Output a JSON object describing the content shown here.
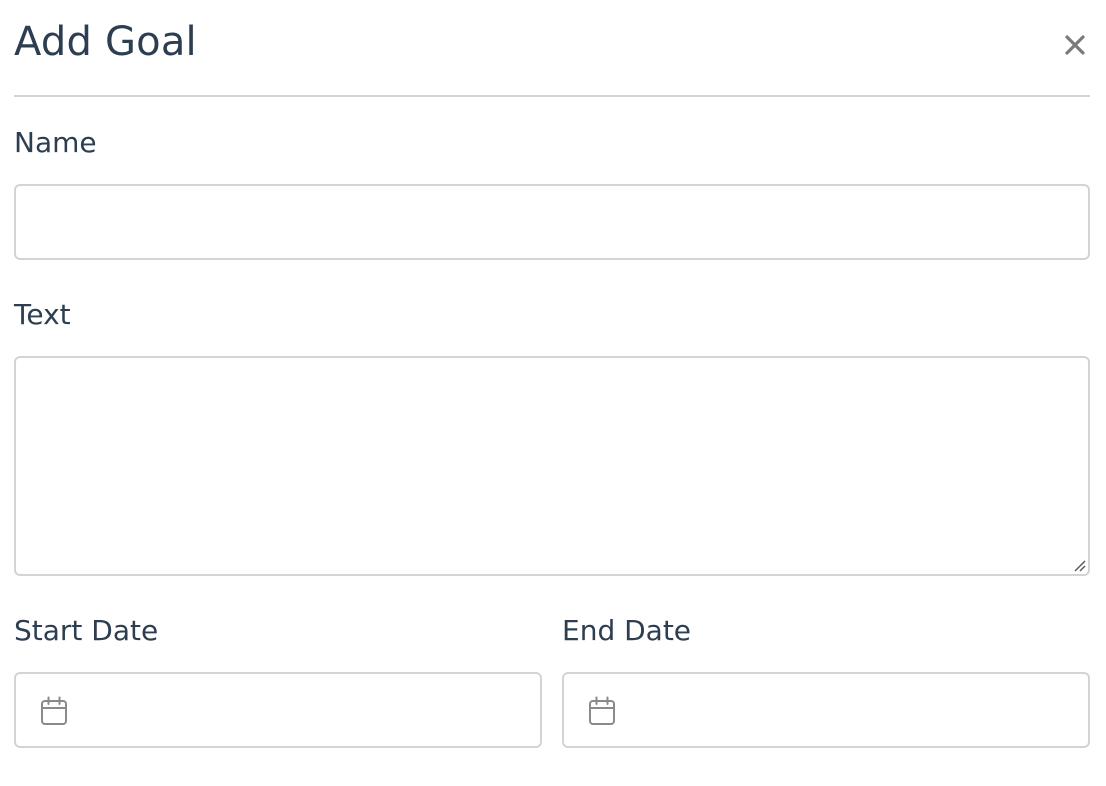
{
  "dialog": {
    "title": "Add Goal",
    "close_label": "×"
  },
  "form": {
    "name": {
      "label": "Name",
      "value": "",
      "placeholder": ""
    },
    "text": {
      "label": "Text",
      "value": "",
      "placeholder": ""
    },
    "start_date": {
      "label": "Start Date",
      "value": "",
      "placeholder": ""
    },
    "end_date": {
      "label": "End Date",
      "value": "",
      "placeholder": ""
    }
  },
  "icons": {
    "close": "close-icon",
    "calendar": "calendar-icon",
    "resize": "resize-grip-icon"
  },
  "colors": {
    "text": "#2c3e50",
    "border": "#d4d4d4",
    "icon": "#8a8a8a",
    "background": "#ffffff"
  }
}
